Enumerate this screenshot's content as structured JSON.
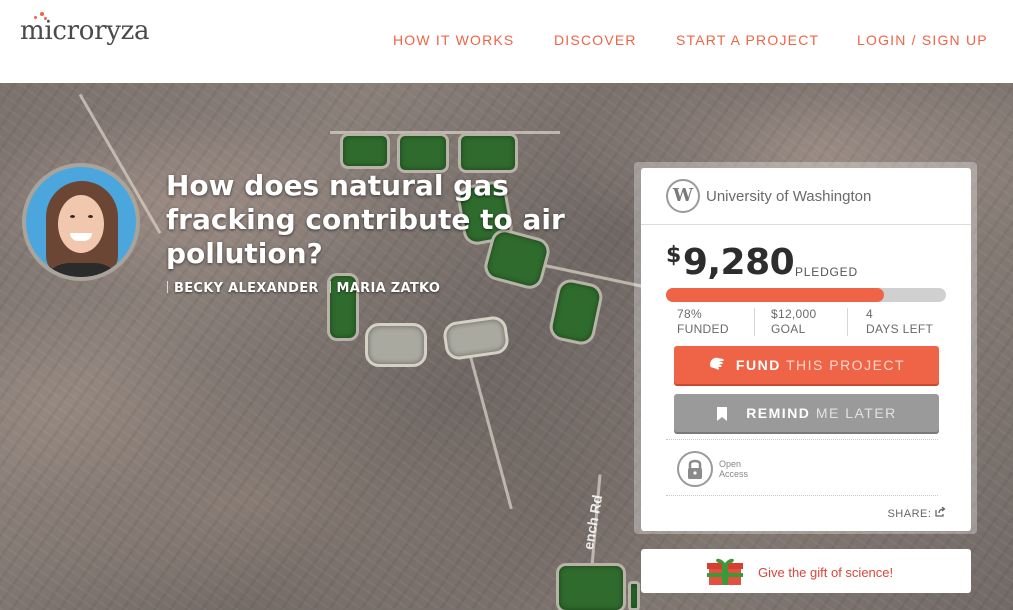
{
  "brand": {
    "logo_text": "microryza",
    "accent": "#ef6446"
  },
  "nav": {
    "how_it_works": "HOW IT WORKS",
    "discover": "DISCOVER",
    "start_project": "START A PROJECT",
    "login": "LOGIN / SIGN UP"
  },
  "hero": {
    "title": "How does natural gas fracking contribute to air pollution?",
    "authors": [
      "BECKY ALEXANDER",
      "MARIA ZATKO"
    ],
    "map_label": "ench Rd"
  },
  "card": {
    "university": "University of Washington",
    "university_logo_letter": "W",
    "currency": "$",
    "amount": "9,280",
    "pledged_label": "PLEDGED",
    "progress_fraction": 0.78,
    "stats": [
      {
        "value": "78%",
        "label": "FUNDED"
      },
      {
        "value": "$12,000",
        "label": "GOAL"
      },
      {
        "value": "4",
        "label": "DAYS LEFT"
      }
    ],
    "fund_button": {
      "strong": "FUND",
      "light": "THIS PROJECT",
      "icon": "hand-icon"
    },
    "remind_button": {
      "strong": "REMIND",
      "light": "ME LATER",
      "icon": "bookmark-icon"
    },
    "open_access": {
      "line1": "Open",
      "line2": "Access",
      "icon": "lock-icon"
    },
    "share_label": "SHARE:"
  },
  "gift": {
    "text": "Give the gift of science!",
    "icon": "gift-icon"
  }
}
